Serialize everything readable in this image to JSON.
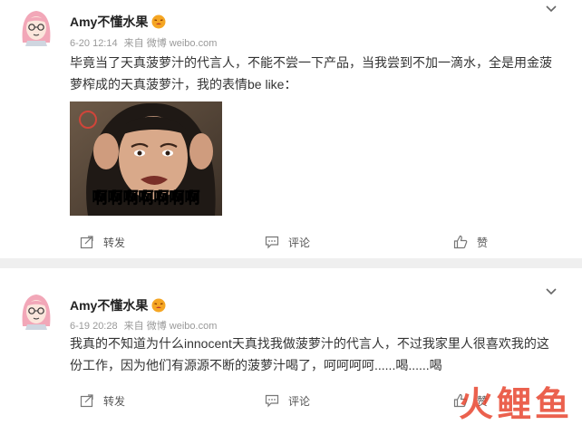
{
  "posts": [
    {
      "author": "Amy不懂水果",
      "date": "6-20 12:14",
      "source": "来自 微博 weibo.com",
      "lines": [
        "毕竟当了天真菠萝汁的代言人，不能不尝一下产品，当我尝到不加一滴水，全是用金菠",
        "萝榨成的天真菠萝汁，我的表情be like："
      ],
      "image_caption": "啊啊啊啊啊啊啊",
      "repost_label": "转发",
      "comment_label": "评论",
      "like_label": "赞"
    },
    {
      "author": "Amy不懂水果",
      "date": "6-19 20:28",
      "source": "来自 微博 weibo.com",
      "lines": [
        "我真的不知道为什么innocent天真找我做菠萝汁的代言人，不过我家里人很喜欢我的这",
        "份工作，因为他们有源源不断的菠萝汁喝了，呵呵呵呵......喝......喝"
      ],
      "repost_label": "转发",
      "comment_label": "评论",
      "like_label": "赞"
    }
  ],
  "icons": {
    "chevron": "chevron-down-icon",
    "repost": "share-icon",
    "comment": "comment-icon",
    "like": "thumbs-up-icon"
  },
  "watermark": "火鲤鱼",
  "colors": {
    "accent": "#e8452f",
    "background": "#efefef",
    "card": "#ffffff",
    "meta": "#999999"
  }
}
